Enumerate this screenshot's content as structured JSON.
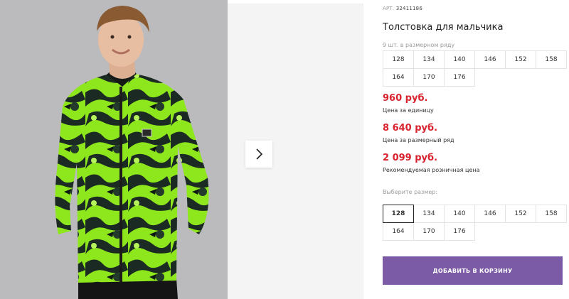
{
  "product": {
    "art_label": "АРТ.",
    "art_number": "32411186",
    "title": "Толстовка для мальчика",
    "size_count_text": "9 шт. в размерном ряду",
    "size_row": [
      "128",
      "134",
      "140",
      "146",
      "152",
      "158",
      "164",
      "170",
      "176"
    ]
  },
  "prices": {
    "unit_price": "960 руб.",
    "unit_label": "Цена за единицу",
    "row_price": "8 640 руб.",
    "row_label": "Цена за размерный ряд",
    "retail_price": "2 099 руб.",
    "retail_label": "Рекомендуемая розничная цена"
  },
  "size_select": {
    "label": "Выберите размер:",
    "options": [
      "128",
      "134",
      "140",
      "146",
      "152",
      "158",
      "164",
      "170",
      "176"
    ],
    "selected": "128"
  },
  "cart": {
    "button_label": "ДОБАВИТЬ В КОРЗИНУ"
  },
  "colors": {
    "accent": "#7b5aa6",
    "price": "#d9232f",
    "jacket_green": "#8ee61c",
    "jacket_dark": "#1b2a22"
  },
  "icons": {
    "next": "chevron-right-icon"
  }
}
